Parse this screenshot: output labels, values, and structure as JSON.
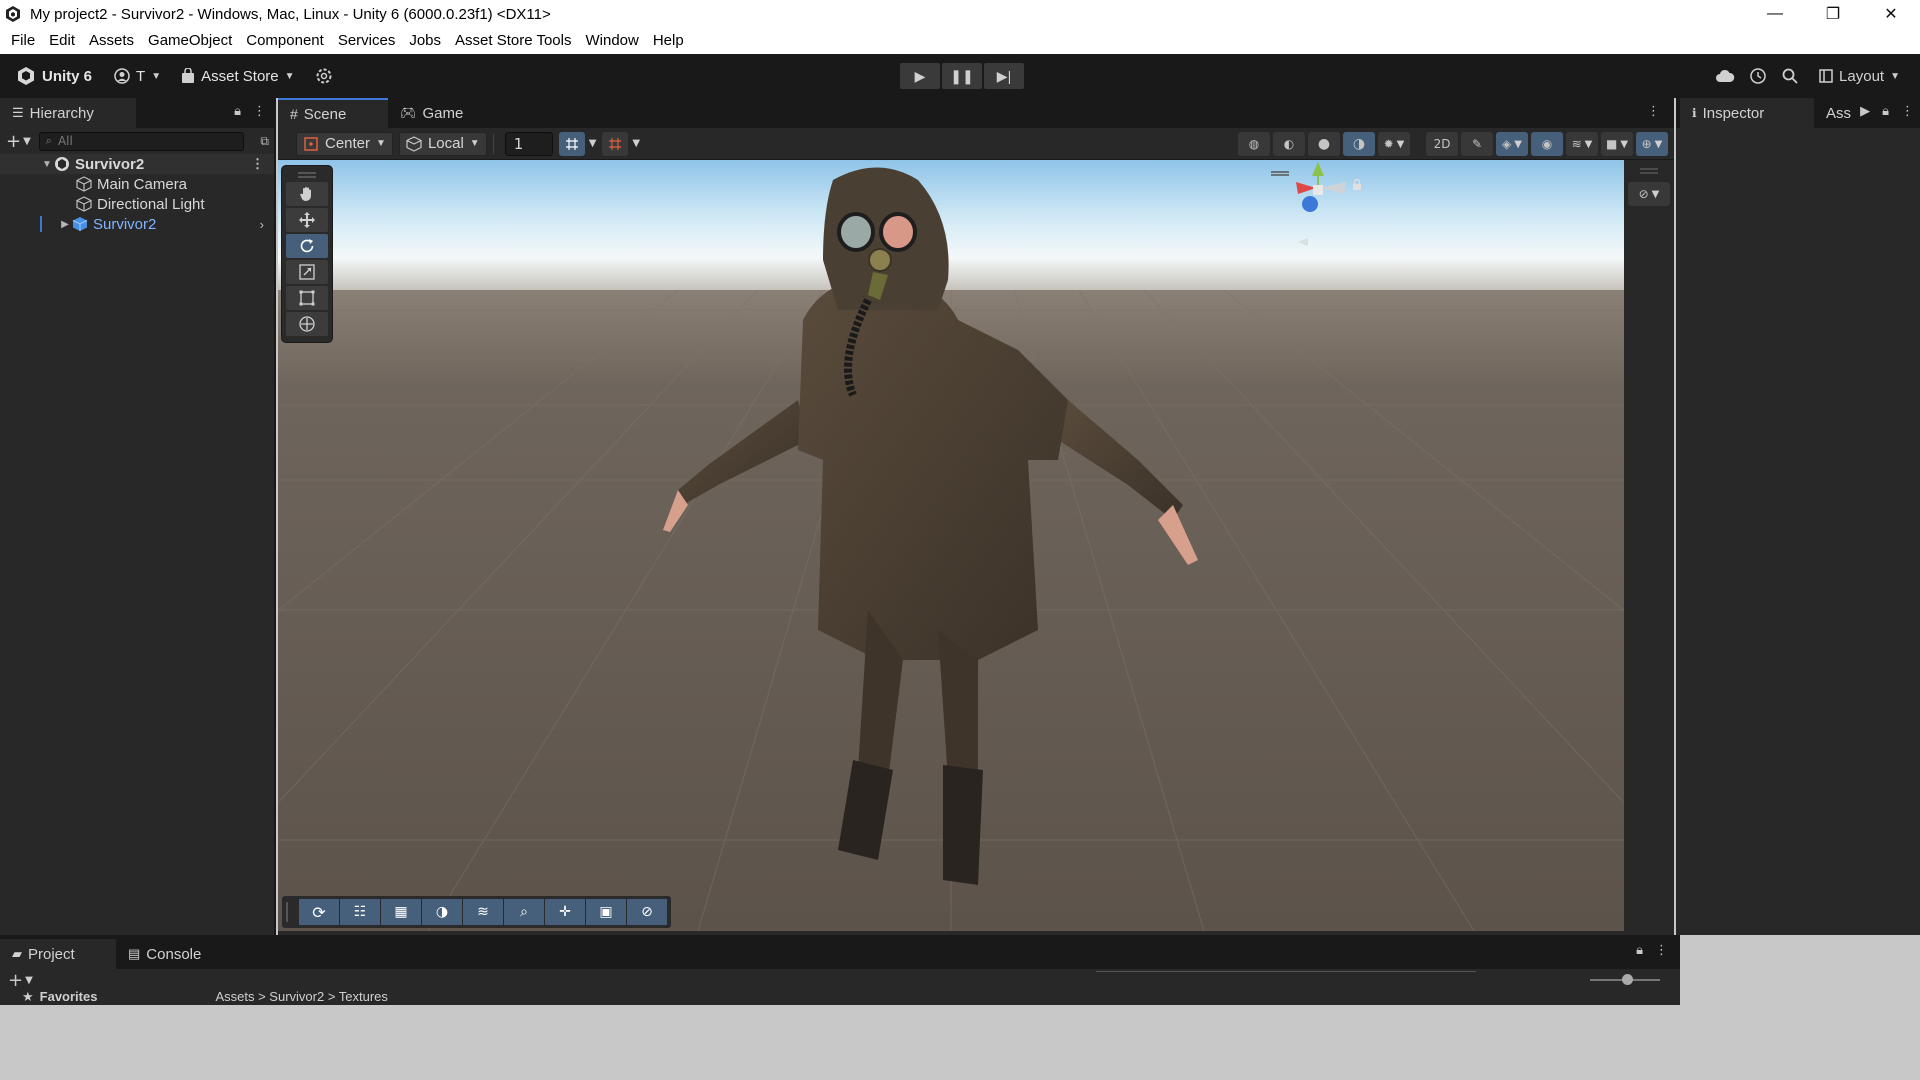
{
  "window": {
    "title": "My project2 - Survivor2 - Windows, Mac, Linux - Unity 6 (6000.0.23f1) <DX11>",
    "minimize": "—",
    "maximize": "❐",
    "close": "✕"
  },
  "menu": [
    "File",
    "Edit",
    "Assets",
    "GameObject",
    "Component",
    "Services",
    "Jobs",
    "Asset Store Tools",
    "Window",
    "Help"
  ],
  "toolbar": {
    "unity_label": "Unity 6",
    "account_label": "T",
    "asset_store_label": "Asset Store",
    "layout_label": "Layout"
  },
  "hierarchy": {
    "tab_label": "Hierarchy",
    "search_placeholder": "All",
    "scene_name": "Survivor2",
    "items": [
      {
        "label": "Main Camera",
        "selected": false
      },
      {
        "label": "Directional Light",
        "selected": false
      },
      {
        "label": "Survivor2",
        "selected": true
      }
    ]
  },
  "scene": {
    "tabs": [
      {
        "label": "Scene",
        "active": true
      },
      {
        "label": "Game",
        "active": false
      }
    ],
    "pivot_mode": "Center",
    "pivot_rotation": "Local",
    "grid_value": "1",
    "active_tool": "rotate"
  },
  "gizmo": {
    "y_label": "y"
  },
  "inspector": {
    "tabs": [
      {
        "label": "Inspector",
        "active": true
      },
      {
        "label": "Ass",
        "active": false
      }
    ]
  },
  "project": {
    "tabs": [
      {
        "label": "Project",
        "active": true
      },
      {
        "label": "Console",
        "active": false
      }
    ],
    "favorites_label": "Favorites",
    "breadcrumb": "Assets > Survivor2 > Textures"
  },
  "colors": {
    "accent": "#46607c",
    "selected_text": "#7fb4ff",
    "panel_bg": "#282828",
    "toolbar_bg": "#191919"
  }
}
